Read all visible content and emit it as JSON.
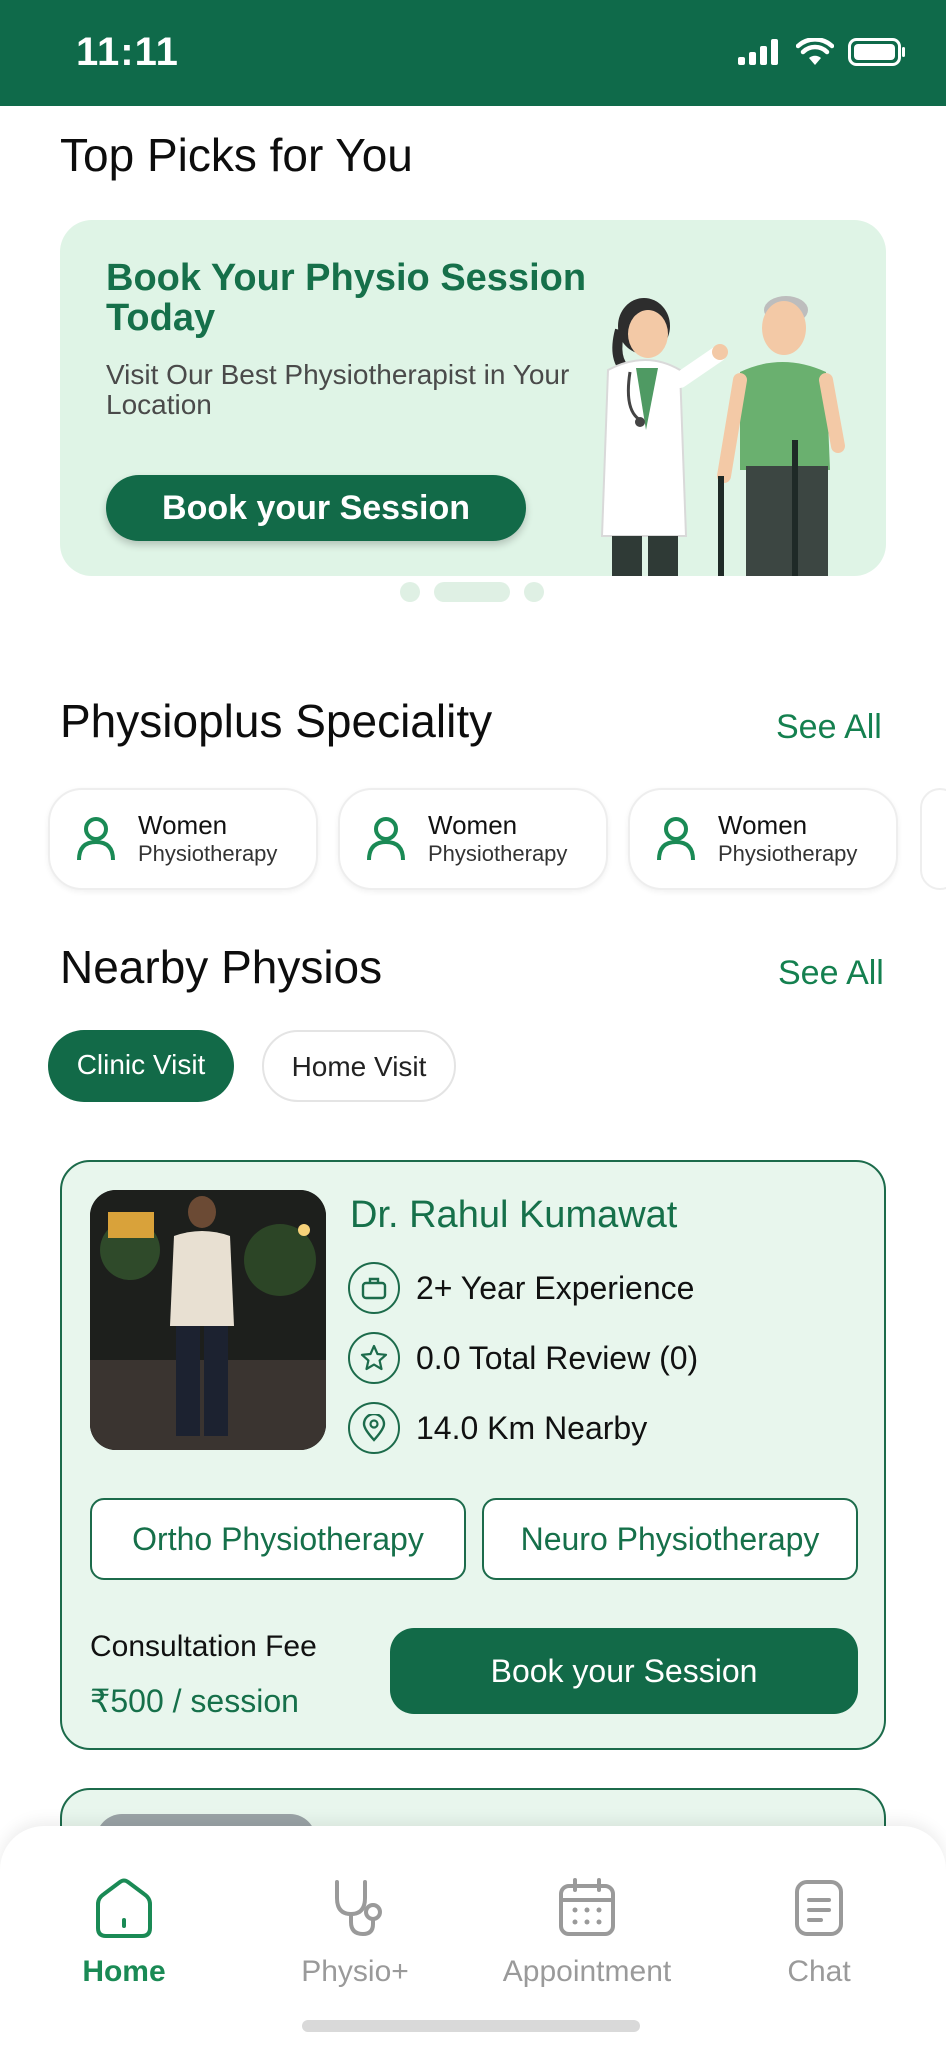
{
  "status_bar": {
    "time": "11:11"
  },
  "top_picks": {
    "title": "Top Picks for You",
    "banner": {
      "headline": "Book Your Physio Session Today",
      "subtitle": "Visit Our Best Physiotherapist in Your Location",
      "button": "Book your Session"
    },
    "carousel": {
      "count": 3,
      "active_index": 1
    }
  },
  "speciality": {
    "title": "Physioplus Speciality",
    "see_all": "See All",
    "items": [
      {
        "line1": "Women",
        "line2": "Physiotherapy",
        "icon": "person-icon"
      },
      {
        "line1": "Women",
        "line2": "Physiotherapy",
        "icon": "person-icon"
      },
      {
        "line1": "Women",
        "line2": "Physiotherapy",
        "icon": "person-icon"
      }
    ]
  },
  "nearby": {
    "title": "Nearby Physios",
    "see_all": "See All",
    "tabs": [
      {
        "label": "Clinic Visit",
        "active": true
      },
      {
        "label": "Home Visit",
        "active": false
      }
    ],
    "physio": {
      "name": "Dr. Rahul Kumawat",
      "experience": "2+ Year Experience",
      "review": "0.0 Total Review (0)",
      "distance": "14.0 Km Nearby",
      "tags": [
        "Ortho Physiotherapy",
        "Neuro Physiotherapy"
      ],
      "fee_label": "Consultation Fee",
      "fee_value": "₹500 / session",
      "book_button": "Book your Session"
    }
  },
  "bottom_nav": {
    "items": [
      {
        "label": "Home",
        "icon": "home-icon",
        "active": true
      },
      {
        "label": "Physio+",
        "icon": "stethoscope-icon",
        "active": false
      },
      {
        "label": "Appointment",
        "icon": "calendar-icon",
        "active": false
      },
      {
        "label": "Chat",
        "icon": "chat-icon",
        "active": false
      }
    ]
  },
  "colors": {
    "primary": "#126a48",
    "accent_text": "#16704a",
    "banner_bg": "#dff4e6",
    "card_bg": "#e8f6ed"
  }
}
